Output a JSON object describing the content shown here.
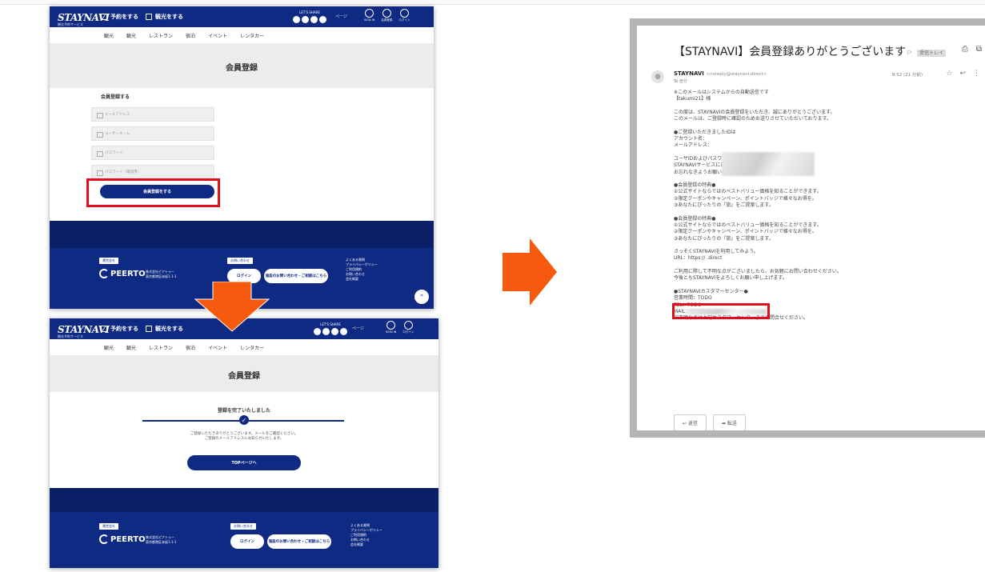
{
  "colors": {
    "brand_navy": "#0e2a82",
    "arrow_orange": "#f55a0e",
    "highlight_red": "#e00f1b"
  },
  "site": {
    "logo_text": "STAYNAVI",
    "logo_sub": "観光予約サービス",
    "nav_reserve": "予約をする",
    "nav_review": "観光をする",
    "social_label": "LET'S SHARE",
    "lang": "ページ",
    "icon_labels": [
      "SIGN IN",
      "会員登録",
      "ログイン"
    ],
    "subnav": [
      "観光",
      "観光",
      "レストラン",
      "宿泊",
      "イベント",
      "レンタカー"
    ],
    "page_title": "会員登録"
  },
  "screen1": {
    "form_heading": "会員登録する",
    "field_placeholders": [
      "メールアドレス",
      "ユーザーネーム",
      "パスワード",
      "パスワード（確認用）"
    ],
    "submit_label": "会員登録をする"
  },
  "screen2": {
    "done_message": "登録を完了いたしました",
    "done_note_1": "ご登録いただきありがとうございます。メールをご確認ください。",
    "done_note_2": "ご登録のメールアドレスにお知らせいたします。",
    "top_button": "TOPページへ"
  },
  "footer": {
    "tag_company": "運営会社",
    "brand": "PEERTO",
    "corp_name": "株式会社ピアトゥー",
    "corp_address": "東京都港区赤坂1-1-1",
    "tag_contact": "お問い合わせ",
    "btn_login": "ログイン",
    "btn_contact": "施設のお問い合わせ・ご相談はこちら",
    "links": [
      "よくある質問",
      "プライバシーポリシー",
      "ご利用規約",
      "お問い合わせ",
      "会社概要"
    ]
  },
  "email": {
    "subject": "【STAYNAVI】会員登録ありがとうございます",
    "inbox_tag": "受信トレイ",
    "sender_name": "STAYNAVI",
    "sender_addr": "<noreply@staynavi.direct>",
    "to": "To 自分",
    "date": "9:52 (21 分前)",
    "greeting": "※このメールはシステムからの自動送信です\n【takumi21】様",
    "p1": "この度は、STAYNAVIの会員登録をいただき、誠にありがとうございます。\nこのメールは、ご登録時に確認のためお送りさせていただいております。",
    "p2_head": "●ご登録いただきましたIDは",
    "p2_lines": "アカウント名：\nメールアドレス：",
    "p3": "ユーザIDおよびパスワードは、\nSTAYNAVIサービスにログインする際に必要となります。\nお忘れなきようお願いいたします。",
    "p4_head": "●会員登録の特典●",
    "p4": "①公式サイトならではのベストバリュー価格を知ることができます。\n②限定クーポンやキャンペーン、ポイントバッジで様々なお得を。\n③あなたにぴったりの『旅』をご提案します。",
    "p5_head": "●会員登録の特典●",
    "p5": "①公式サイトならではのベストバリュー価格を知ることができます。\n②限定クーポンやキャンペーン、ポイントバッジで様々なお得を。\n③あなたにぴったりの『旅』をご提案します。",
    "p6_head": "さっそくSTAYNAVIを利用してみよう。",
    "p6_link": "URL：https://                    .direct",
    "p7": "ご利用に際して不明な点がございましたら、お気軽にお問い合わせください。\n今後ともSTAYNAVIをよろしくお願い申し上げます。",
    "p8_head": "●STAYNAVIカスタマーセンター●",
    "p8": "営業時間：TODO\nTEL：TODO\nMAIL：TODO\nご不明な点は上記カスタマーセンターまでお問合せください。",
    "btn_reply": "返信",
    "btn_forward": "転送"
  }
}
